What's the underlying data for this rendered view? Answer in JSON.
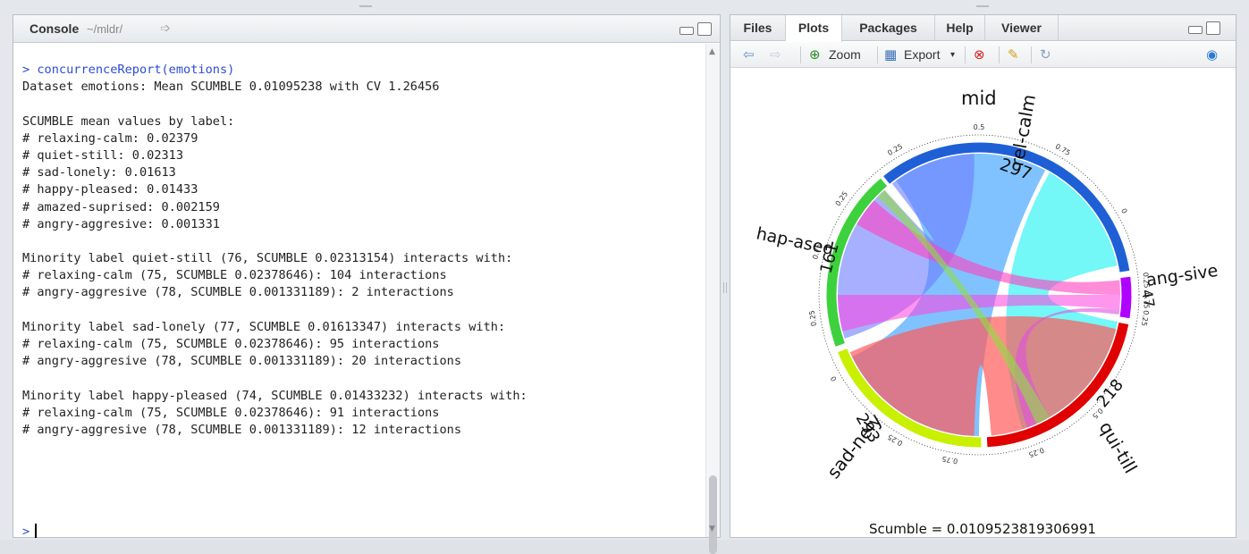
{
  "console": {
    "title": "Console",
    "path": "~/mldr/",
    "lines": [
      {
        "text": "> concurrenceReport(emotions)",
        "cmd": true
      },
      {
        "text": "Dataset emotions: Mean SCUMBLE 0.01095238 with CV 1.26456"
      },
      {
        "text": ""
      },
      {
        "text": "SCUMBLE mean values by label:"
      },
      {
        "text": "# relaxing-calm: 0.02379"
      },
      {
        "text": "# quiet-still: 0.02313"
      },
      {
        "text": "# sad-lonely: 0.01613"
      },
      {
        "text": "# happy-pleased: 0.01433"
      },
      {
        "text": "# amazed-suprised: 0.002159"
      },
      {
        "text": "# angry-aggresive: 0.001331"
      },
      {
        "text": ""
      },
      {
        "text": "Minority label quiet-still (76, SCUMBLE 0.02313154) interacts with:"
      },
      {
        "text": "# relaxing-calm (75, SCUMBLE 0.02378646): 104 interactions"
      },
      {
        "text": "# angry-aggresive (78, SCUMBLE 0.001331189): 2 interactions"
      },
      {
        "text": ""
      },
      {
        "text": "Minority label sad-lonely (77, SCUMBLE 0.01613347) interacts with:"
      },
      {
        "text": "# relaxing-calm (75, SCUMBLE 0.02378646): 95 interactions"
      },
      {
        "text": "# angry-aggresive (78, SCUMBLE 0.001331189): 20 interactions"
      },
      {
        "text": ""
      },
      {
        "text": "Minority label happy-pleased (74, SCUMBLE 0.01433232) interacts with:"
      },
      {
        "text": "# relaxing-calm (75, SCUMBLE 0.02378646): 91 interactions"
      },
      {
        "text": "# angry-aggresive (78, SCUMBLE 0.001331189): 12 interactions"
      }
    ],
    "prompt": ">"
  },
  "tabs": [
    "Files",
    "Plots",
    "Packages",
    "Help",
    "Viewer"
  ],
  "active_tab": "Plots",
  "toolbar": {
    "zoom_label": "Zoom",
    "export_label": "Export"
  },
  "plot": {
    "top_label": "mid",
    "labels": {
      "relax": "rel-calm",
      "happy": "hap-ased",
      "angry": "ang-sive",
      "sad": "sad-nely",
      "quiet": "qui-till"
    },
    "numbers": {
      "relax": "297",
      "happy": "161",
      "angry": "47",
      "sad": "293",
      "quiet": "218"
    },
    "ticks": [
      "0.25",
      "0.5",
      "0.75",
      "0",
      "0.25",
      "0.75",
      "0.25",
      "0.5",
      "0.25",
      "0.75",
      "0.25",
      "0",
      "0.25",
      "0.75",
      "0.25"
    ],
    "caption": "Scumble = 0.0109523819306991",
    "colors": {
      "relax": "#1f5fd6",
      "happy": "#3ed13e",
      "angry": "#b000ff",
      "sad": "#c8f000",
      "quiet": "#e00000"
    }
  }
}
